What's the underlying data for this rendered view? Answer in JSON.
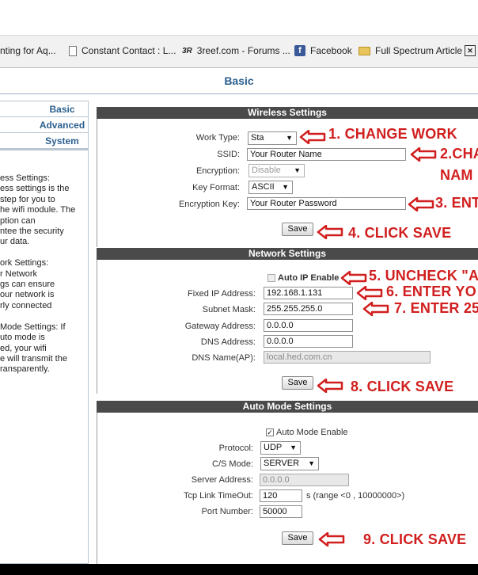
{
  "bookmarks": [
    {
      "label": "nting for Aq...",
      "icon": "page-icon"
    },
    {
      "label": "Constant Contact : L...",
      "icon": "page-icon"
    },
    {
      "label": "3reef.com - Forums ...",
      "icon": "3reef-icon"
    },
    {
      "label": "Facebook",
      "icon": "facebook-icon"
    },
    {
      "label": "Full Spectrum Article",
      "icon": "folder-icon"
    }
  ],
  "page": {
    "title": "Basic"
  },
  "sidebar": {
    "nav": [
      "Basic",
      "Advanced",
      "System"
    ],
    "help_text": "ess Settings:\ness settings is the\nstep for you to\nhe wifi module. The\nption can\nntee the security\nur data.\n\nork Settings:\nr Network\ngs can ensure\nour network is\nrly connected\n\nMode Settings: If\nuto mode is\ned, your wifi\ne will transmit the\nransparently."
  },
  "wireless": {
    "header": "Wireless Settings",
    "work_type_label": "Work Type:",
    "work_type_value": "Sta",
    "ssid_label": "SSID:",
    "ssid_value": "Your Router Name",
    "encryption_label": "Encryption:",
    "encryption_value": "Disable",
    "key_format_label": "Key Format:",
    "key_format_value": "ASCII",
    "encryption_key_label": "Encryption Key:",
    "encryption_key_value": "Your Router Password",
    "save_label": "Save"
  },
  "network": {
    "header": "Network Settings",
    "auto_ip_label": "Auto IP Enable",
    "auto_ip_checked": false,
    "fixed_ip_label": "Fixed IP Address:",
    "fixed_ip_value": "192.168.1.131",
    "subnet_label": "Subnet Mask:",
    "subnet_value": "255.255.255.0",
    "gateway_label": "Gateway Address:",
    "gateway_value": "0.0.0.0",
    "dns_label": "DNS Address:",
    "dns_value": "0.0.0.0",
    "dns_name_label": "DNS Name(AP):",
    "dns_name_value": "local.hed.com.cn",
    "save_label": "Save"
  },
  "auto_mode": {
    "header": "Auto Mode Settings",
    "enable_label": "Auto Mode Enable",
    "enable_checked": true,
    "protocol_label": "Protocol:",
    "protocol_value": "UDP",
    "cs_mode_label": "C/S Mode:",
    "cs_mode_value": "SERVER",
    "server_address_label": "Server Address:",
    "server_address_value": "0.0.0.0",
    "tcp_timeout_label": "Tcp Link TimeOut:",
    "tcp_timeout_value": "120",
    "tcp_timeout_unit": "s (range <0 , 10000000>)",
    "port_label": "Port Number:",
    "port_value": "50000",
    "save_label": "Save"
  },
  "annotations": [
    "1. CHANGE WORK",
    "2.CHA",
    "NAM",
    "3. ENT",
    "4. CLICK SAVE",
    "5. UNCHECK \"A",
    "6. ENTER YO",
    "7. ENTER 25",
    "8. CLICK SAVE",
    "9. CLICK SAVE"
  ],
  "colors": {
    "annotation": "#d11e1e",
    "section_bar": "#4a4a4a",
    "nav_text": "#2b5f8f"
  }
}
